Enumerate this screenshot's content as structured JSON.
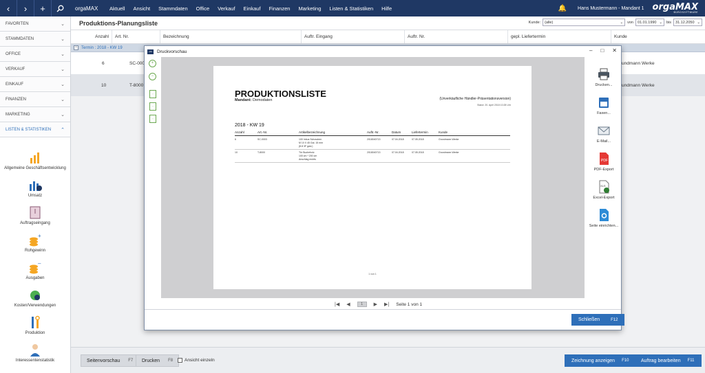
{
  "app": {
    "name": "orgaMAX"
  },
  "menu": [
    "Aktuell",
    "Ansicht",
    "Stammdaten",
    "Office",
    "Verkauf",
    "Einkauf",
    "Finanzen",
    "Marketing",
    "Listen & Statistiken",
    "Hilfe"
  ],
  "user": "Hans Mustermann - Mandant 1",
  "logo": {
    "main": "orgaMAX",
    "sub": "BÜROSOFTWARE"
  },
  "sidebar": {
    "sections": [
      "FAVORITEN",
      "STAMMDATEN",
      "OFFICE",
      "VERKAUF",
      "EINKAUF",
      "FINANZEN",
      "MARKETING",
      "LISTEN & STATISTIKEN"
    ],
    "items": [
      "Allgemeine Geschäftsentwicklung",
      "Umsatz",
      "Auftragseingang",
      "Rohgewinn",
      "Ausgaben",
      "Kosten/Verwendungen",
      "Produktion",
      "Interessentenstatistik"
    ]
  },
  "main": {
    "title": "Produktions-Planungsliste",
    "filter": {
      "kunde_label": "Kunde:",
      "kunde_value": "(alle)",
      "von_label": "von",
      "von_value": "01.01.1990",
      "bis_label": "bis",
      "bis_value": "31.12.2050"
    },
    "columns": [
      "Anzahl",
      "Art. Nr.",
      "Bezeichnung",
      "Auftr. Eingang",
      "Auftr. Nr.",
      "gepl. Liefertermin",
      "Kunde"
    ],
    "group": "Termin : 2018 - KW 19",
    "rows": [
      {
        "anzahl": "6",
        "artnr": "SC-000",
        "kunde": "undmann Werke"
      },
      {
        "anzahl": "10",
        "artnr": "T-8000",
        "kunde": "undmann Werke"
      }
    ]
  },
  "bottom": {
    "seitenvorschau": "Seitenvorschau",
    "seitenvorschau_key": "F7",
    "drucken": "Drucken",
    "drucken_key": "F8",
    "ansicht": "Ansicht einzeln",
    "zeichnung": "Zeichnung anzeigen",
    "zeichnung_key": "F10",
    "auftrag": "Auftrag bearbeiten",
    "auftrag_key": "F11"
  },
  "dialog": {
    "title": "Druckvorschau",
    "close": "Schließen",
    "close_key": "F12",
    "pager": "Seite 1 von 1",
    "page_num": "1",
    "tools": [
      "Drucken...",
      "Faxen...",
      "E-Mail...",
      "PDF-Export",
      "Excel-Export",
      "Seite einrichten..."
    ],
    "doc": {
      "title": "PRODUKTIONSLISTE",
      "mandant_label": "Mandant:",
      "mandant": "Demodaten",
      "note": "(Unverkäufliche Händler-Präsentationsversion)",
      "stand": "Stand: 20. April 2018 10:28 Uhr",
      "group": "2018 - KW 19",
      "headers": [
        "Anzahl",
        "Art.-Nr.",
        "Artikelbezeichnung",
        "Auftr.-Nr.",
        "Datum",
        "Liefertermin",
        "Kunde"
      ],
      "rows": [
        {
          "anzahl": "6",
          "artnr": "SC-0003",
          "bez1": "100 Inbus Schrauben",
          "bez2": "M 10 X 45 Gal. 15 mm",
          "bez3": "(8.8 3F galv.)",
          "auftr": "2018040713",
          "datum": "07.04.2018",
          "liefer": "07.05.2018",
          "kunde": "Grundmann Werke"
        },
        {
          "anzahl": "10",
          "artnr": "T-8000",
          "bez1": "Tür Bucheholz",
          "bez2": "100 cm * 200 cm",
          "bez3": "Anschlag rechts",
          "auftr": "2018040713",
          "datum": "07.04.2018",
          "liefer": "07.05.2018",
          "kunde": "Grundmann Werke"
        }
      ],
      "footer": "1 von 1"
    }
  },
  "colors": {
    "topbar": "#1f3864",
    "accent": "#2e6fb9",
    "group_bg": "#cfd8e4"
  }
}
